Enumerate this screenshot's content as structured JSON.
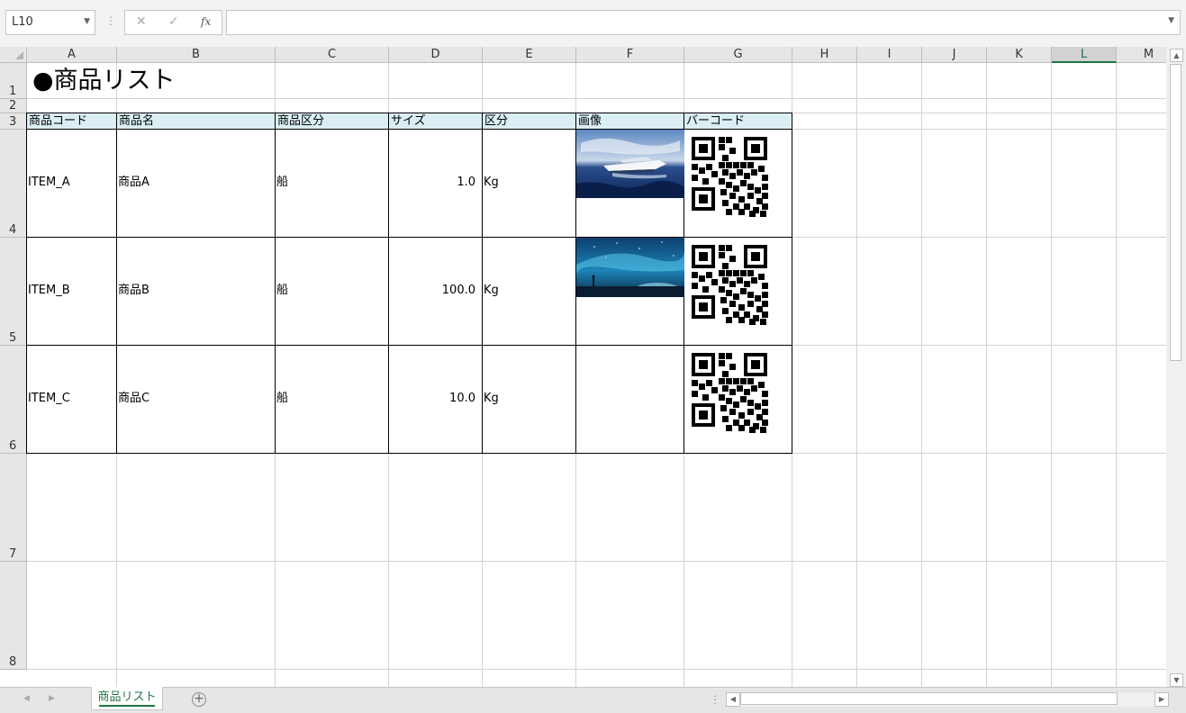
{
  "formula_bar": {
    "name_box": "L10",
    "name_box_arrow": "▼",
    "dots": "⋮",
    "cancel_icon": "✕",
    "enter_icon": "✓",
    "fx_label": "fx",
    "formula_value": "",
    "expand_arrow": "▼"
  },
  "columns": [
    "A",
    "B",
    "C",
    "D",
    "E",
    "F",
    "G",
    "H",
    "I",
    "J",
    "K",
    "L",
    "M"
  ],
  "selected_column": "L",
  "rows": [
    "1",
    "2",
    "3",
    "4",
    "5",
    "6",
    "7",
    "8"
  ],
  "sheet": {
    "title": "●商品リスト",
    "headers": [
      "商品コード",
      "商品名",
      "商品区分",
      "サイズ",
      "区分",
      "画像",
      "バーコード"
    ],
    "items": [
      {
        "code": "ITEM_A",
        "name": "商品A",
        "category": "船",
        "size": "1.0",
        "unit": "Kg",
        "image": "yacht-photo"
      },
      {
        "code": "ITEM_B",
        "name": "商品B",
        "category": "船",
        "size": "100.0",
        "unit": "Kg",
        "image": "night-sky-photo"
      },
      {
        "code": "ITEM_C",
        "name": "商品C",
        "category": "船",
        "size": "10.0",
        "unit": "Kg",
        "image": ""
      }
    ]
  },
  "scrollbar": {
    "up": "▲",
    "down": "▼",
    "left": "◀",
    "right": "▶"
  },
  "tabs": {
    "nav_prev": "◀",
    "nav_next": "▶",
    "active": "商品リスト",
    "add_label": "+",
    "dots": "⋮"
  },
  "colors": {
    "header_fill": "#daeef3",
    "accent": "#217346",
    "grid_line": "#d4d4d4"
  }
}
